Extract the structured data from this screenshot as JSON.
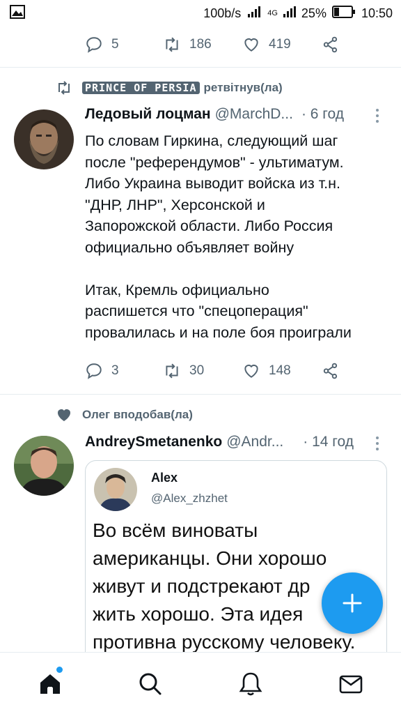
{
  "status_bar": {
    "speed": "100b/s",
    "network": "4G",
    "battery": "25%",
    "time": "10:50",
    "icons": [
      "gallery-icon",
      "signal-icon",
      "battery-icon"
    ]
  },
  "top_actions": {
    "replies": "5",
    "retweets": "186",
    "likes": "419"
  },
  "tweet1": {
    "retweeted_by": "PRINCE OF PERSIA",
    "retweet_suffix": "ретвітнув(ла)",
    "author_name": "Ледовый лоцман",
    "author_handle": "@MarchD...",
    "time": "· 6 год",
    "text": "По словам Гиркина, следующий шаг\nпосле \"референдумов\" - ультиматум.\nЛибо Украина выводит войска из т.н.\n\"ДНР, ЛНР\", Херсонской и\nЗапорожской области. Либо Россия\nофициально объявляет войну\n\nИтак, Кремль официально\nраспишется что \"спецоперация\"\nпровалилась и на поле боя проиграли",
    "replies": "3",
    "retweets": "30",
    "likes": "148"
  },
  "tweet2": {
    "liked_by": "Олег вподобав(ла)",
    "author_name": "AndreySmetanenko",
    "author_handle": "@Andr...",
    "time": "· 14 год",
    "quote": {
      "name": "Alex",
      "handle": "@Alex_zhzhet",
      "text": "Во всём виноваты\nамериканцы. Они хорошо\nживут и подстрекают др\nжить хорошо. Эта идея\nпротивна русскому человеку."
    }
  },
  "colors": {
    "accent": "#1d9bf0",
    "secondary_text": "#536471",
    "divider": "#e6ecf0"
  }
}
